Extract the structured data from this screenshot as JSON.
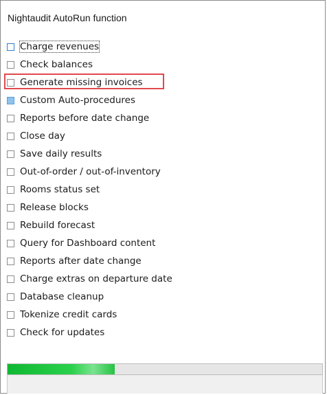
{
  "window": {
    "title": "Nightaudit AutoRun function"
  },
  "functions": [
    {
      "label": "Charge revenues",
      "checked": false,
      "focused": true
    },
    {
      "label": "Check balances",
      "checked": false
    },
    {
      "label": "Generate missing invoices",
      "checked": false,
      "highlighted": true
    },
    {
      "label": "Custom Auto-procedures",
      "checked": false,
      "indeterminate": true
    },
    {
      "label": "Reports before date change",
      "checked": false
    },
    {
      "label": "Close day",
      "checked": false
    },
    {
      "label": "Save daily results",
      "checked": false
    },
    {
      "label": "Out-of-order / out-of-inventory",
      "checked": false
    },
    {
      "label": "Rooms status set",
      "checked": false
    },
    {
      "label": "Release blocks",
      "checked": false
    },
    {
      "label": "Rebuild forecast",
      "checked": false
    },
    {
      "label": "Query for Dashboard content",
      "checked": false
    },
    {
      "label": "Reports after date change",
      "checked": false
    },
    {
      "label": "Charge extras on departure date",
      "checked": false
    },
    {
      "label": "Database cleanup",
      "checked": false
    },
    {
      "label": "Tokenize credit cards",
      "checked": false
    },
    {
      "label": "Check for updates",
      "checked": false
    }
  ],
  "progress": {
    "fraction": 0.34
  },
  "colors": {
    "highlight": "#e0484c",
    "progress": "#1fc43e",
    "focus_checkbox": "#2a7fd4",
    "indeterminate_checkbox": "#8ec3ee"
  }
}
